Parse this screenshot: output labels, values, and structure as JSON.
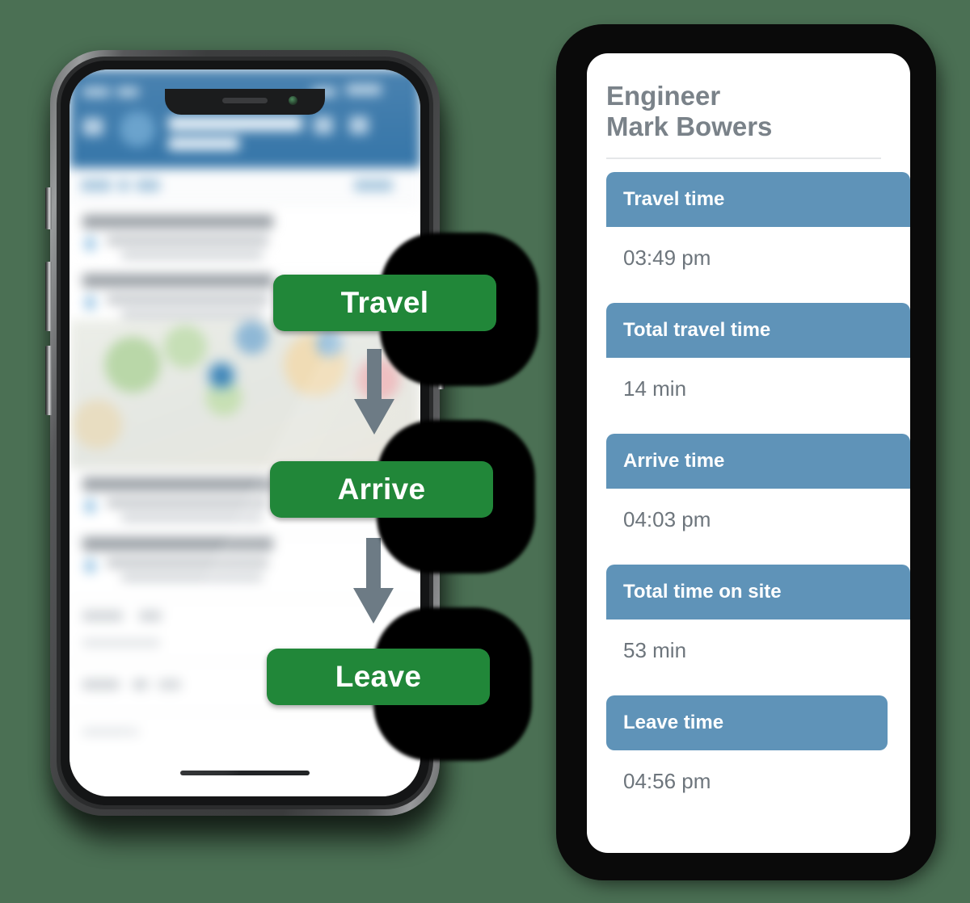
{
  "colors": {
    "page_background": "#4b7054",
    "badge_green": "#218739",
    "label_blue": "#5f93b8",
    "title_gray": "#7a8289",
    "value_gray": "#6d757c",
    "arrow_gray": "#6d7b85",
    "app_header_blue": "#3d7aab"
  },
  "phone": {
    "device_name": "smartphone-mockup",
    "notch": {
      "speaker_icon": "speaker-slot-icon",
      "camera_icon": "front-camera-icon"
    },
    "home_indicator": "home-indicator-bar",
    "screen_content_description": "blurred-field-service-app"
  },
  "flow": {
    "steps": [
      {
        "label": "Travel",
        "icon": "travel-step-badge"
      },
      {
        "label": "Arrive",
        "icon": "arrive-step-badge"
      },
      {
        "label": "Leave",
        "icon": "leave-step-badge"
      }
    ],
    "arrows": [
      {
        "name": "down-arrow-icon"
      },
      {
        "name": "down-arrow-icon"
      }
    ]
  },
  "card": {
    "title": "Engineer\nMark Bowers",
    "title_line1": "Engineer",
    "title_line2": "Mark Bowers",
    "rows": [
      {
        "label": "Travel time",
        "value": "03:49 pm",
        "clipped": true
      },
      {
        "label": "Total travel time",
        "value": "14 min",
        "clipped": true
      },
      {
        "label": "Arrive time",
        "value": "04:03 pm",
        "clipped": true
      },
      {
        "label": "Total time on site",
        "value": "53 min",
        "clipped": true
      },
      {
        "label": "Leave time",
        "value": "04:56 pm",
        "clipped": false
      }
    ]
  }
}
